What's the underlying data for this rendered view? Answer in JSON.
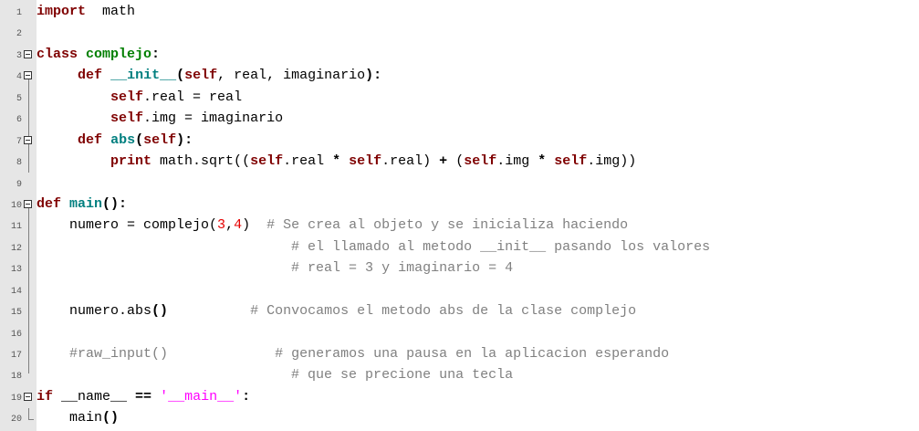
{
  "editor": {
    "lines": [
      {
        "n": "1",
        "tokens": [
          [
            "kw",
            "import"
          ],
          [
            "",
            "  math"
          ]
        ]
      },
      {
        "n": "2",
        "tokens": []
      },
      {
        "n": "3",
        "fold": true,
        "tokens": [
          [
            "kw",
            "class"
          ],
          [
            "",
            " "
          ],
          [
            "cls",
            "complejo"
          ],
          [
            "op",
            ":"
          ]
        ]
      },
      {
        "n": "4",
        "fold": true,
        "tokens": [
          [
            "",
            " "
          ],
          [
            "kw",
            "def"
          ],
          [
            "",
            " "
          ],
          [
            "fn",
            "__init__"
          ],
          [
            "op",
            "("
          ],
          [
            "self",
            "self"
          ],
          [
            "",
            ", real, imaginario"
          ],
          [
            "op",
            ")"
          ],
          [
            "op",
            ":"
          ]
        ]
      },
      {
        "n": "5",
        "tokens": [
          [
            "",
            "     "
          ],
          [
            "self",
            "self"
          ],
          [
            "",
            ".real = real"
          ]
        ]
      },
      {
        "n": "6",
        "tokens": [
          [
            "",
            "     "
          ],
          [
            "self",
            "self"
          ],
          [
            "",
            ".img = imaginario"
          ]
        ]
      },
      {
        "n": "7",
        "fold": true,
        "tokens": [
          [
            "",
            " "
          ],
          [
            "kw",
            "def"
          ],
          [
            "",
            " "
          ],
          [
            "fn",
            "abs"
          ],
          [
            "op",
            "("
          ],
          [
            "self",
            "self"
          ],
          [
            "op",
            "):"
          ]
        ]
      },
      {
        "n": "8",
        "tokens": [
          [
            "",
            "     "
          ],
          [
            "kw",
            "print"
          ],
          [
            "",
            " math.sqrt(("
          ],
          [
            "self",
            "self"
          ],
          [
            "",
            ".real "
          ],
          [
            "op",
            "*"
          ],
          [
            "",
            " "
          ],
          [
            "self",
            "self"
          ],
          [
            "",
            ".real) "
          ],
          [
            "op",
            "+"
          ],
          [
            "",
            " ("
          ],
          [
            "self",
            "self"
          ],
          [
            "",
            ".img "
          ],
          [
            "op",
            "*"
          ],
          [
            "",
            " "
          ],
          [
            "self",
            "self"
          ],
          [
            "",
            ".img))"
          ]
        ]
      },
      {
        "n": "9",
        "tokens": []
      },
      {
        "n": "10",
        "fold": true,
        "tokens": [
          [
            "kw",
            "def"
          ],
          [
            "",
            " "
          ],
          [
            "fn",
            "main"
          ],
          [
            "op",
            "():"
          ]
        ]
      },
      {
        "n": "11",
        "tokens": [
          [
            "",
            "    numero = complejo("
          ],
          [
            "num",
            "3"
          ],
          [
            "",
            ","
          ],
          [
            "num",
            "4"
          ],
          [
            "",
            ")  "
          ],
          [
            "cmt",
            "# Se crea al objeto y se inicializa haciendo"
          ]
        ]
      },
      {
        "n": "12",
        "tokens": [
          [
            "",
            "                               "
          ],
          [
            "cmt",
            "# el llamado al metodo __init__ pasando los valores"
          ]
        ]
      },
      {
        "n": "13",
        "tokens": [
          [
            "",
            "                               "
          ],
          [
            "cmt",
            "# real = 3 y imaginario = 4"
          ]
        ]
      },
      {
        "n": "14",
        "tokens": []
      },
      {
        "n": "15",
        "tokens": [
          [
            "",
            "    numero.abs"
          ],
          [
            "op",
            "()"
          ],
          [
            "",
            "          "
          ],
          [
            "cmt",
            "# Convocamos el metodo abs de la clase complejo"
          ]
        ]
      },
      {
        "n": "16",
        "tokens": []
      },
      {
        "n": "17",
        "tokens": [
          [
            "",
            "    "
          ],
          [
            "cmt",
            "#raw_input()"
          ],
          [
            "",
            "             "
          ],
          [
            "cmt",
            "# generamos una pausa en la aplicacion esperando"
          ]
        ]
      },
      {
        "n": "18",
        "tokens": [
          [
            "",
            "                               "
          ],
          [
            "cmt",
            "# que se precione una tecla"
          ]
        ]
      },
      {
        "n": "19",
        "fold": true,
        "tokens": [
          [
            "kw",
            "if"
          ],
          [
            "",
            " __name__ "
          ],
          [
            "op",
            "=="
          ],
          [
            "",
            " "
          ],
          [
            "str",
            "'__main__'"
          ],
          [
            "op",
            ":"
          ]
        ]
      },
      {
        "n": "20",
        "tokens": [
          [
            "",
            "    main"
          ],
          [
            "op",
            "()"
          ]
        ]
      }
    ]
  }
}
